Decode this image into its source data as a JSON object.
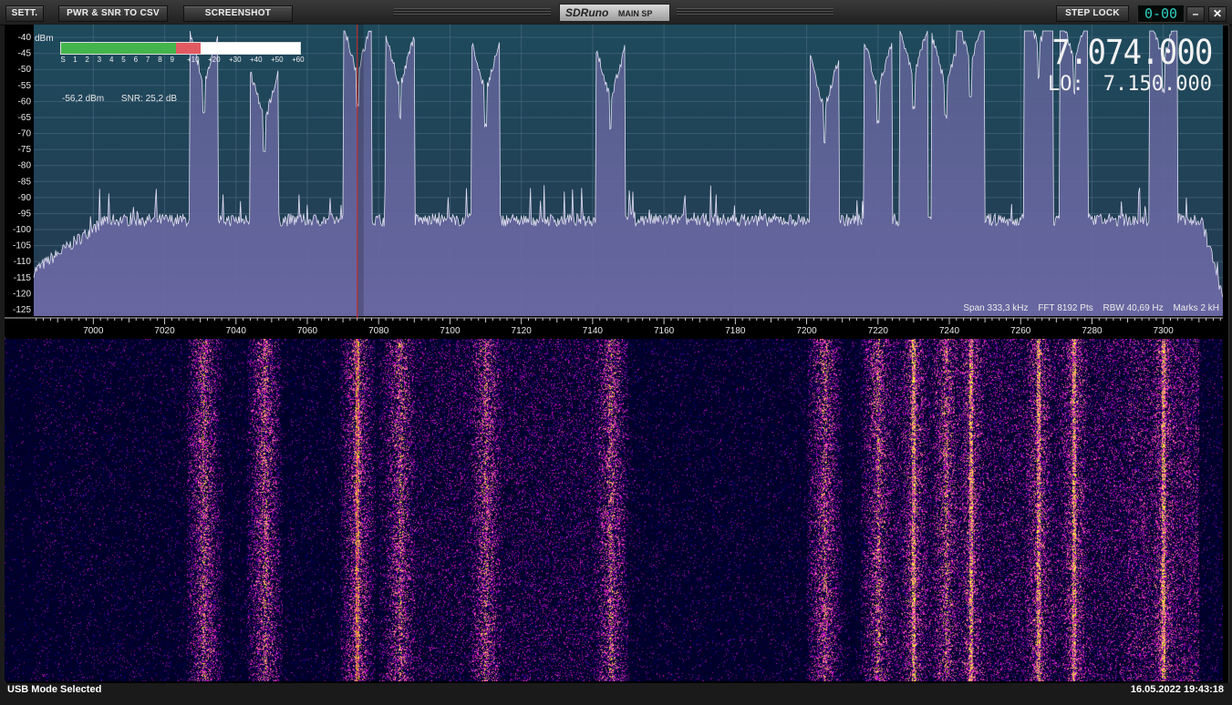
{
  "toolbar": {
    "settings_label": "SETT.",
    "csv_label": "PWR & SNR TO CSV",
    "screenshot_label": "SCREENSHOT",
    "step_lock_label": "STEP LOCK",
    "led_display": "0-00",
    "minimize_icon": "minimize-icon",
    "close_icon": "close-icon"
  },
  "logo": {
    "brand": "SDRuno",
    "subtitle": "MAIN SP"
  },
  "spectrum": {
    "unit_label": "dBm",
    "power_readout": "-56,2 dBm",
    "snr_readout": "SNR: 25,2 dB",
    "frequency": "7.074.000",
    "lo_label": "LO:",
    "lo_frequency": "7.150.000",
    "span": "Span 333,3 kHz",
    "fft": "FFT 8192 Pts",
    "rbw": "RBW 40,69 Hz",
    "marks": "Marks 2 kH",
    "colors": {
      "bg_top": "#1e4a5c",
      "bg_bottom": "#243a52",
      "fill": "#6e6aa8",
      "line": "#e0dff0",
      "marker": "#c03030"
    }
  },
  "smeter": {
    "scale": [
      "S",
      "1",
      "2",
      "3",
      "4",
      "5",
      "6",
      "7",
      "8",
      "9",
      "+10",
      "+20",
      "+30",
      "+40",
      "+50",
      "+60"
    ],
    "level_s9": 1,
    "level_over": 0.25
  },
  "chart_data": {
    "type": "line",
    "x_ticks": [
      "7000",
      "7020",
      "7040",
      "7060",
      "7080",
      "7100",
      "7120",
      "7140",
      "7160",
      "7180",
      "7200",
      "7220",
      "7240",
      "7260",
      "7280",
      "7300"
    ],
    "y_ticks": [
      "-40",
      "-45",
      "-50",
      "-55",
      "-60",
      "-65",
      "-70",
      "-75",
      "-80",
      "-85",
      "-90",
      "-95",
      "-100",
      "-105",
      "-110",
      "-115",
      "-120",
      "-125"
    ],
    "xlim": [
      6983.3,
      7316.7
    ],
    "ylim": [
      -127,
      -38
    ],
    "tuned_frequency_khz": 7074,
    "noise_floor_dbm": -97,
    "peaks": [
      {
        "x": 7031,
        "y": -64
      },
      {
        "x": 7048,
        "y": -76
      },
      {
        "x": 7074,
        "y": -61
      },
      {
        "x": 7086,
        "y": -65
      },
      {
        "x": 7110,
        "y": -67
      },
      {
        "x": 7145,
        "y": -69
      },
      {
        "x": 7205,
        "y": -72
      },
      {
        "x": 7220,
        "y": -66
      },
      {
        "x": 7230,
        "y": -62
      },
      {
        "x": 7239,
        "y": -65
      },
      {
        "x": 7246,
        "y": -58
      },
      {
        "x": 7265,
        "y": -53
      },
      {
        "x": 7275,
        "y": -57
      },
      {
        "x": 7300,
        "y": -57
      }
    ]
  },
  "status": {
    "mode": "USB Mode Selected",
    "datetime": "16.05.2022 19:43:18"
  }
}
